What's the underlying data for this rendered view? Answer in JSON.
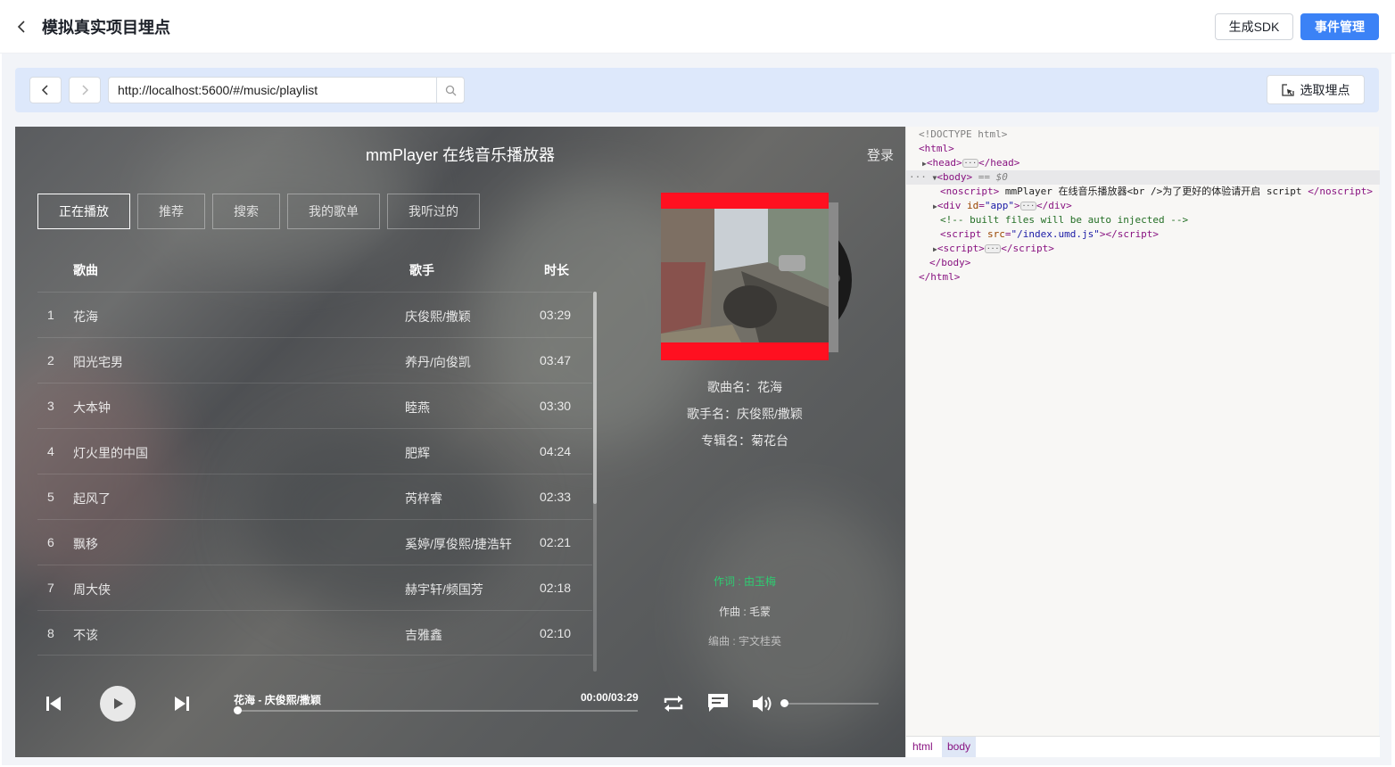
{
  "header": {
    "title": "模拟真实项目埋点",
    "back_icon": "chevron-left-icon",
    "sdk_button": "生成SDK",
    "events_button": "事件管理",
    "accent_color": "#3b82f6"
  },
  "urlbar": {
    "url": "http://localhost:5600/#/music/playlist",
    "pick_button": "选取埋点"
  },
  "player": {
    "title": "mmPlayer 在线音乐播放器",
    "login": "登录",
    "tabs": [
      {
        "label": "正在播放",
        "active": true
      },
      {
        "label": "推荐",
        "active": false
      },
      {
        "label": "搜索",
        "active": false
      },
      {
        "label": "我的歌单",
        "active": false
      },
      {
        "label": "我听过的",
        "active": false
      }
    ],
    "columns": {
      "song": "歌曲",
      "artist": "歌手",
      "duration": "时长"
    },
    "rows": [
      {
        "index": "1",
        "song": "花海",
        "artist": "庆俊熙/撒颖",
        "duration": "03:29"
      },
      {
        "index": "2",
        "song": "阳光宅男",
        "artist": "养丹/向俊凯",
        "duration": "03:47"
      },
      {
        "index": "3",
        "song": "大本钟",
        "artist": "睦燕",
        "duration": "03:30"
      },
      {
        "index": "4",
        "song": "灯火里的中国",
        "artist": "肥辉",
        "duration": "04:24"
      },
      {
        "index": "5",
        "song": "起风了",
        "artist": "芮梓睿",
        "duration": "02:33"
      },
      {
        "index": "6",
        "song": "飘移",
        "artist": "奚婷/厚俊熙/捷浩轩",
        "duration": "02:21"
      },
      {
        "index": "7",
        "song": "周大侠",
        "artist": "赫宇轩/频国芳",
        "duration": "02:18"
      },
      {
        "index": "8",
        "song": "不该",
        "artist": "吉雅鑫",
        "duration": "02:10"
      }
    ],
    "info": {
      "song": "歌曲名：花海",
      "artist": "歌手名：庆俊熙/撒颖",
      "album": "专辑名：菊花台"
    },
    "lyrics": {
      "lyricist": "作词 : 由玉梅",
      "composer": "作曲 : 毛蒙",
      "arranger": "编曲 : 宇文桂英",
      "highlight_color": "#2ecc71"
    },
    "now_playing": "花海 - 庆俊熙/撒颖",
    "time": "00:00/03:29",
    "progress": 0,
    "volume": 0
  },
  "devtools": {
    "doctype": "<!DOCTYPE html>",
    "noscript_text": " mmPlayer 在线音乐播放器<br />为了更好的体验请开启 script ",
    "comment": "<!-- built files will be auto injected -->",
    "script_src": "/index.umd.js",
    "div_id": "app",
    "selected_marker": "== $0",
    "breadcrumbs": [
      "html",
      "body"
    ]
  }
}
